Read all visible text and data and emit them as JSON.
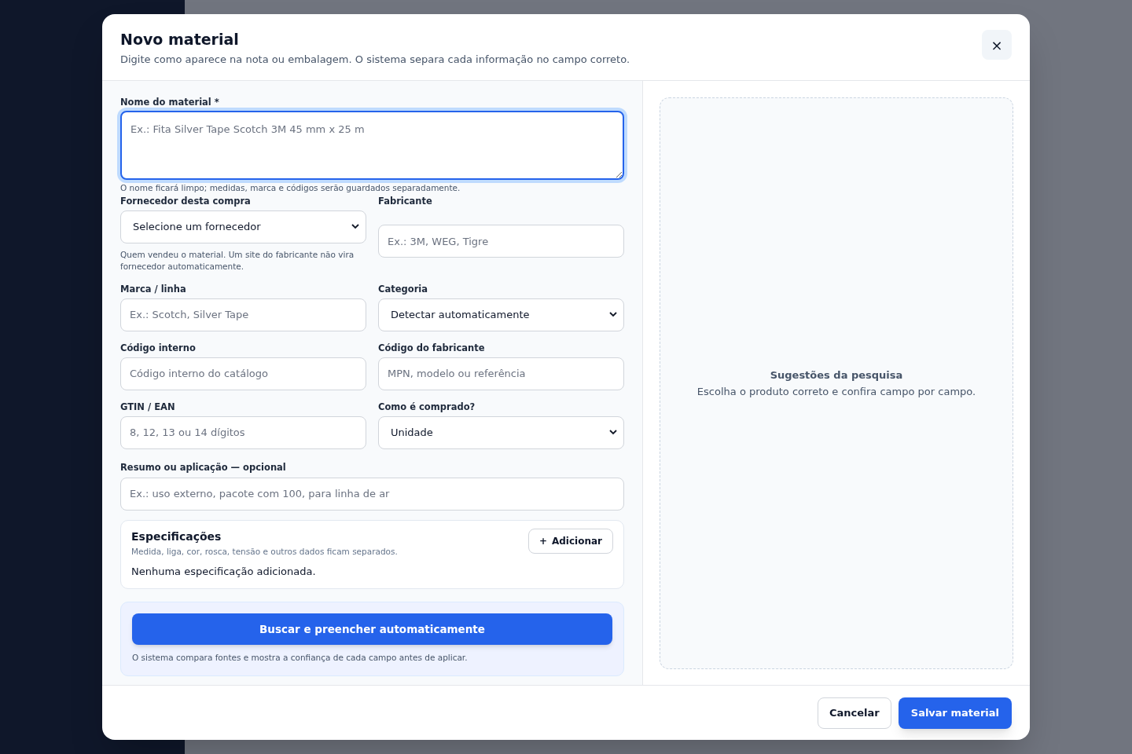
{
  "modal": {
    "title": "Novo material",
    "subtitle": "Digite como aparece na nota ou embalagem. O sistema separa cada informação no campo correto.",
    "close": "×"
  },
  "name_field": {
    "label": "Nome do material *",
    "placeholder": "Ex.: Fita Silver Tape Scotch 3M 45 mm x 25 m",
    "focused": true,
    "hint": "O nome ficará limpo; medidas, marca e códigos serão guardados separadamente."
  },
  "field_rows": [
    [
      {
        "label": "Fornecedor desta compra",
        "kind": "select",
        "value": "Selecione um fornecedor",
        "hint": "Quem vendeu o material. Um site do fabricante não vira fornecedor automaticamente."
      },
      {
        "label": "Fabricante",
        "kind": "input",
        "placeholder": "Ex.: 3M, WEG, Tigre"
      }
    ],
    [
      {
        "label": "Marca / linha",
        "kind": "input",
        "placeholder": "Ex.: Scotch, Silver Tape"
      },
      {
        "label": "Categoria",
        "kind": "select",
        "value": "Detectar automaticamente"
      }
    ],
    [
      {
        "label": "Código interno",
        "kind": "input",
        "placeholder": "Código interno do catálogo"
      },
      {
        "label": "Código do fabricante",
        "kind": "input",
        "placeholder": "MPN, modelo ou referência"
      }
    ],
    [
      {
        "label": "GTIN / EAN",
        "kind": "input",
        "placeholder": "8, 12, 13 ou 14 dígitos"
      },
      {
        "label": "Como é comprado?",
        "kind": "select",
        "value": "Unidade"
      }
    ]
  ],
  "summary_field": {
    "label": "Resumo ou aplicação — opcional",
    "placeholder": "Ex.: uso externo, pacote com 100, para linha de ar"
  },
  "specs": {
    "title": "Especificações",
    "subtitle": "Medida, liga, cor, rosca, tensão e outros dados ficam separados.",
    "add_icon": "+",
    "add_label": "Adicionar",
    "empty": "Nenhuma especificação adicionada."
  },
  "autofill": {
    "button": "Buscar e preencher automaticamente",
    "note": "O sistema compara fontes e mostra a confiança de cada campo antes de aplicar."
  },
  "suggestions": {
    "title": "Sugestões da pesquisa",
    "text": "Escolha o produto correto e confira campo por campo."
  },
  "footer": {
    "cancel": "Cancelar",
    "save": "Salvar material"
  }
}
